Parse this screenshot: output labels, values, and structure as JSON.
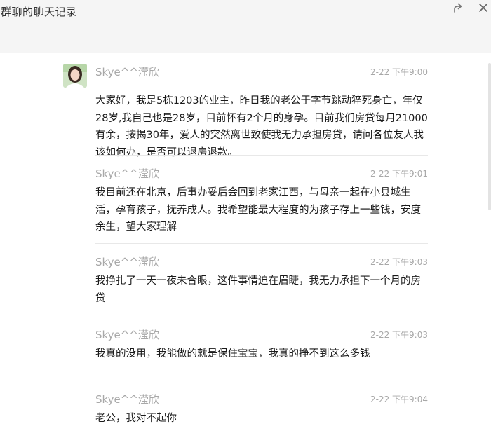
{
  "window": {
    "title": "群聊的聊天记录"
  },
  "icons": {
    "share": "share-icon",
    "close": "close-icon",
    "avatar": "avatar-image"
  },
  "messages": [
    {
      "sender": "Skye^^滢欣",
      "time": "2-22 下午9:00",
      "text": "大家好，我是5栋1203的业主，昨日我的老公于字节跳动猝死身亡，年仅28岁,我自己也是28岁，目前怀有2个月的身孕。目前我们房贷每月21000有余，按揭30年，爱人的突然离世致使我无力承担房贷，请问各位友人我该如何办，是否可以退房退款。"
    },
    {
      "sender": "Skye^^滢欣",
      "time": "2-22 下午9:01",
      "text": "我目前还在北京，后事办妥后会回到老家江西，与母亲一起在小县城生活，孕育孩子，抚养成人。我希望能最大程度的为孩子存上一些钱，安度余生，望大家理解"
    },
    {
      "sender": "Skye^^滢欣",
      "time": "2-22 下午9:03",
      "text": "我挣扎了一天一夜未合眼，这件事情迫在眉睫，我无力承担下一个月的房贷"
    },
    {
      "sender": "Skye^^滢欣",
      "time": "2-22 下午9:03",
      "text": "我真的没用，我能做的就是保住宝宝，我真的挣不到这么多钱"
    },
    {
      "sender": "Skye^^滢欣",
      "time": "2-22 下午9:04",
      "text": "老公，我对不起你"
    }
  ]
}
